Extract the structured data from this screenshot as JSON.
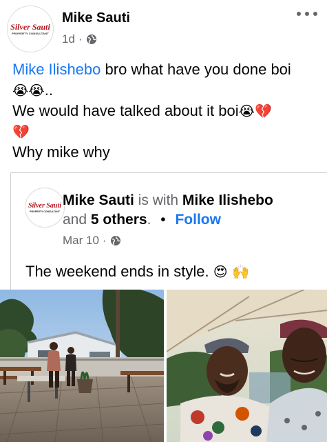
{
  "post": {
    "author": "Mike Sauti",
    "timestamp": "1d",
    "separator": "·",
    "privacy_icon": "globe-icon",
    "avatar_logo": {
      "main": "Silver Sauti",
      "sub": "PROPERTY CONSULTANT"
    },
    "text": {
      "mention": "Mike Ilishebo",
      "line1_rest": " bro what have you done boi",
      "line2_emojis": "😭😭",
      "line2_rest": "..",
      "line3_text": "We would have talked about it boi",
      "line3_emojis": "😭💔",
      "line4_emoji": "💔",
      "line5_text": "Why mike why"
    }
  },
  "shared_post": {
    "author": "Mike Sauti",
    "is_with": "is with",
    "tagged": "Mike Ilishebo",
    "and": "and",
    "others": "5 others",
    "period": ".",
    "bullet": "•",
    "follow_label": "Follow",
    "date": "Mar 10",
    "separator": "·",
    "privacy_icon": "globe-icon",
    "avatar_logo": {
      "main": "Silver Sauti",
      "sub": "PROPERTY CONSULTANT"
    },
    "text": "The weekend ends in style.",
    "text_emojis": "😍 🙌"
  },
  "colors": {
    "link_blue": "#1877f2",
    "secondary_gray": "#65676b",
    "text_black": "#050505",
    "logo_red": "#b3171e"
  }
}
